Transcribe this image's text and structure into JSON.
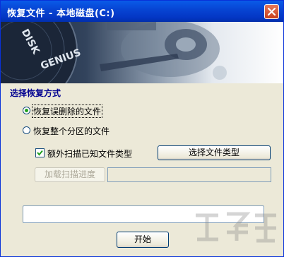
{
  "window": {
    "title": "恢复文件 - 本地磁盘(C:)"
  },
  "banner": {
    "brand_text": "DISK GENIUS"
  },
  "section": {
    "title": "选择恢复方式"
  },
  "options": [
    {
      "label": "恢复误删除的文件",
      "selected": true
    },
    {
      "label": "恢复整个分区的文件",
      "selected": false
    }
  ],
  "extra_scan": {
    "label": "额外扫描已知文件类型",
    "checked": true
  },
  "buttons": {
    "select_types": "选择文件类型",
    "load_progress": "加载扫描进度",
    "start": "开始"
  },
  "colors": {
    "title_bar": "#0a5be8",
    "close_button": "#d7532d",
    "dialog_bg": "#ece9d8",
    "section_title": "#000090"
  }
}
